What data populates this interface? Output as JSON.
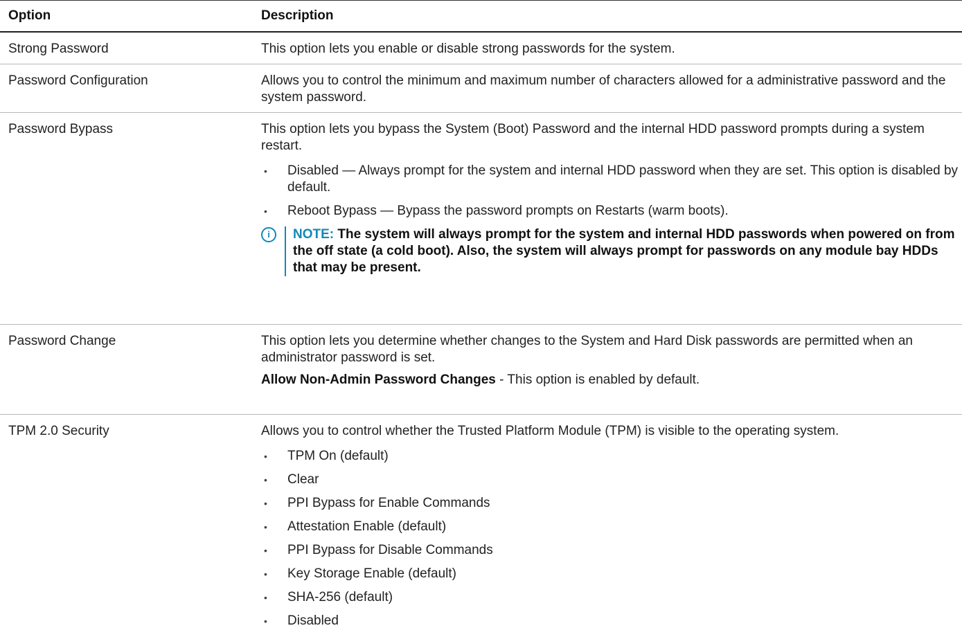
{
  "header": {
    "option": "Option",
    "description": "Description"
  },
  "rows": [
    {
      "option": "Strong Password",
      "paragraphs": [
        "This option lets you enable or disable strong passwords for the system."
      ]
    },
    {
      "option": "Password Configuration",
      "paragraphs": [
        "Allows you to control the minimum and maximum number of characters allowed for a administrative password and the system password."
      ]
    },
    {
      "option": "Password Bypass",
      "paragraphs": [
        "This option lets you bypass the System (Boot) Password and the internal HDD password prompts during a system restart."
      ],
      "bullets": [
        "Disabled — Always prompt for the system and internal HDD password when they are set. This option is disabled by default.",
        "Reboot Bypass — Bypass the password prompts on Restarts (warm boots)."
      ],
      "note": {
        "label": "NOTE:",
        "text": "The system will always prompt for the system and internal HDD passwords when powered on from the off state (a cold boot). Also, the system will always prompt for passwords on any module bay HDDs that may be present."
      }
    },
    {
      "option": "Password Change",
      "paragraphs": [
        "This option lets you determine whether changes to the System and Hard Disk passwords are permitted when an administrator password is set."
      ],
      "setting": {
        "name": "Allow Non-Admin Password Changes",
        "text": "- This option is enabled by default."
      }
    },
    {
      "option": "TPM 2.0 Security",
      "paragraphs": [
        "Allows you to control whether the Trusted Platform Module (TPM) is visible to the operating system."
      ],
      "bullets": [
        "TPM On (default)",
        "Clear",
        "PPI Bypass for Enable Commands",
        "Attestation Enable (default)",
        "PPI Bypass for Disable Commands",
        "Key Storage Enable (default)",
        "SHA-256 (default)",
        "Disabled"
      ]
    }
  ],
  "colors": {
    "accent": "#1288b8",
    "text": "#222222"
  }
}
